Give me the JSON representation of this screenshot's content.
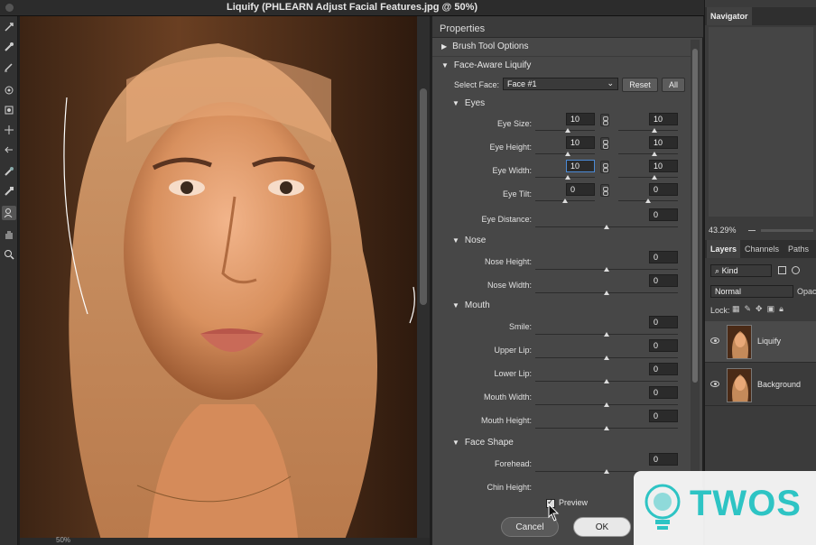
{
  "window": {
    "title": "Liquify (PHLEARN Adjust Facial Features.jpg @ 50%)"
  },
  "status": {
    "zoom": "50%"
  },
  "properties": {
    "title": "Properties",
    "brush_section": "Brush Tool Options",
    "face_section": "Face-Aware Liquify",
    "select_face_label": "Select Face:",
    "select_face_value": "Face #1",
    "reset_label": "Reset",
    "all_label": "All",
    "eyes": {
      "heading": "Eyes",
      "rows": [
        {
          "label": "Eye Size:",
          "left": "10",
          "right": "10",
          "left_pos": 0.55,
          "right_pos": 0.6
        },
        {
          "label": "Eye Height:",
          "left": "10",
          "right": "10",
          "left_pos": 0.55,
          "right_pos": 0.6
        },
        {
          "label": "Eye Width:",
          "left": "10",
          "right": "10",
          "left_pos": 0.55,
          "right_pos": 0.6
        },
        {
          "label": "Eye Tilt:",
          "left": "0",
          "right": "0",
          "left_pos": 0.5,
          "right_pos": 0.5
        }
      ],
      "distance_label": "Eye Distance:",
      "distance_value": "0"
    },
    "nose": {
      "heading": "Nose",
      "rows": [
        {
          "label": "Nose Height:",
          "value": "0"
        },
        {
          "label": "Nose Width:",
          "value": "0"
        }
      ]
    },
    "mouth": {
      "heading": "Mouth",
      "rows": [
        {
          "label": "Smile:",
          "value": "0"
        },
        {
          "label": "Upper Lip:",
          "value": "0"
        },
        {
          "label": "Lower Lip:",
          "value": "0"
        },
        {
          "label": "Mouth Width:",
          "value": "0"
        },
        {
          "label": "Mouth Height:",
          "value": "0"
        }
      ]
    },
    "face_shape": {
      "heading": "Face Shape",
      "rows": [
        {
          "label": "Forehead:",
          "value": "0"
        },
        {
          "label": "Chin Height:",
          "value": ""
        }
      ]
    },
    "preview_label": "Preview",
    "preview_checked": true,
    "cancel_label": "Cancel",
    "ok_label": "OK"
  },
  "navigator": {
    "title": "Navigator",
    "zoom": "43.29%"
  },
  "layers_panel": {
    "tabs": [
      "Layers",
      "Channels",
      "Paths"
    ],
    "filter_label": "Kind",
    "blend_mode": "Normal",
    "opacity_label": "Opac",
    "lock_label": "Lock:",
    "layers": [
      {
        "name": "Liquify",
        "visible": true
      },
      {
        "name": "Background",
        "visible": true
      }
    ]
  },
  "watermark": {
    "text": "TWOS",
    "color": "#2ec4c4"
  },
  "colors": {
    "panel": "#474747",
    "accent_focus": "#4b8ad6",
    "ok_button": "#e8e8e8"
  }
}
